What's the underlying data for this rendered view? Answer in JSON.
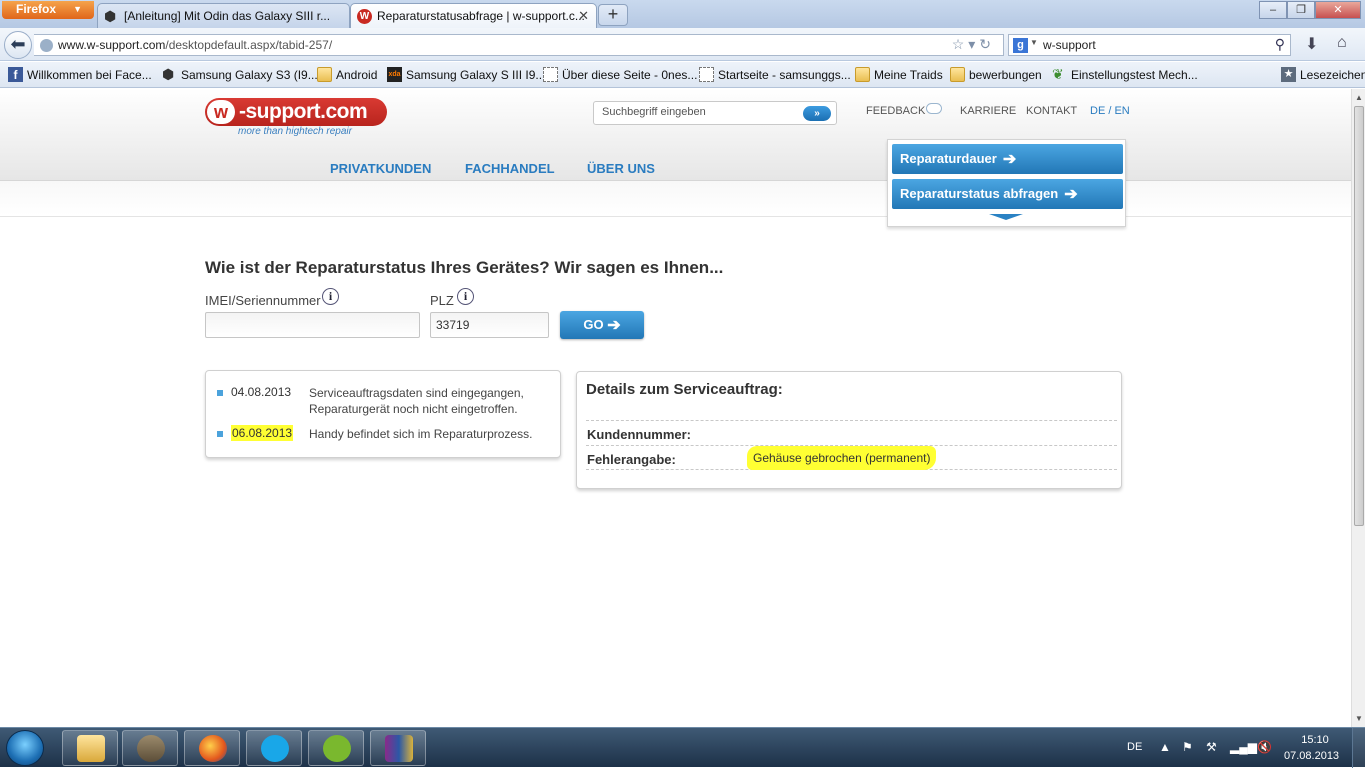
{
  "browser": {
    "app_button": "Firefox",
    "tabs": [
      {
        "title": "[Anleitung] Mit Odin das Galaxy SIII r..."
      },
      {
        "title": "Reparaturstatusabfrage | w-support.c..."
      }
    ],
    "url_host": "www.w-support.com",
    "url_path": "/desktopdefault.aspx/tabid-257/",
    "search_text": "w-support",
    "search_engine_letter": "g",
    "bookmarks": [
      "Willkommen bei Face...",
      "Samsung Galaxy S3 (I9...",
      "Android",
      "Samsung Galaxy S III I9...",
      "Über diese Seite - 0nes...",
      "Startseite - samsunggs...",
      "Meine Traids",
      "bewerbungen",
      "Einstellungstest Mech...",
      "Lesezeichen"
    ]
  },
  "site": {
    "logo_w": "w",
    "logo_brand": "-support.com",
    "logo_tagline": "more than hightech repair",
    "search_placeholder": "Suchbegriff eingeben",
    "search_button": "»",
    "top_links": {
      "feedback": "FEEDBACK",
      "karriere": "KARRIERE",
      "kontakt": "KONTAKT",
      "language": "DE / EN"
    },
    "main_nav": [
      "PRIVATKUNDEN",
      "FACHHANDEL",
      "ÜBER UNS"
    ],
    "quick_buttons": [
      "Reparaturdauer",
      "Reparaturstatus abfragen"
    ],
    "heading": "Wie ist der Reparaturstatus Ihres Gerätes? Wir sagen es Ihnen...",
    "form": {
      "imei_label": "IMEI/Seriennummer",
      "imei_value": "",
      "plz_label": "PLZ",
      "plz_value": "33719",
      "go_label": "GO"
    },
    "history": [
      {
        "date": "04.08.2013",
        "text": "Serviceauftragsdaten sind eingegangen, Reparaturgerät noch nicht eingetroffen."
      },
      {
        "date": "06.08.2013",
        "text": "Handy befindet sich im Reparaturprozess."
      }
    ],
    "details": {
      "title": "Details zum Serviceauftrag:",
      "rows": [
        {
          "key": "Kundennummer:",
          "value": ""
        },
        {
          "key": "Fehlerangabe:",
          "value": "Gehäuse gebrochen (permanent)"
        }
      ]
    }
  },
  "taskbar": {
    "language": "DE",
    "time": "15:10",
    "date": "07.08.2013"
  },
  "colors": {
    "site_blue": "#2a7cc0",
    "button_blue": "#2277b6",
    "logo_red": "#c92a22",
    "highlight": "#ffff33"
  }
}
